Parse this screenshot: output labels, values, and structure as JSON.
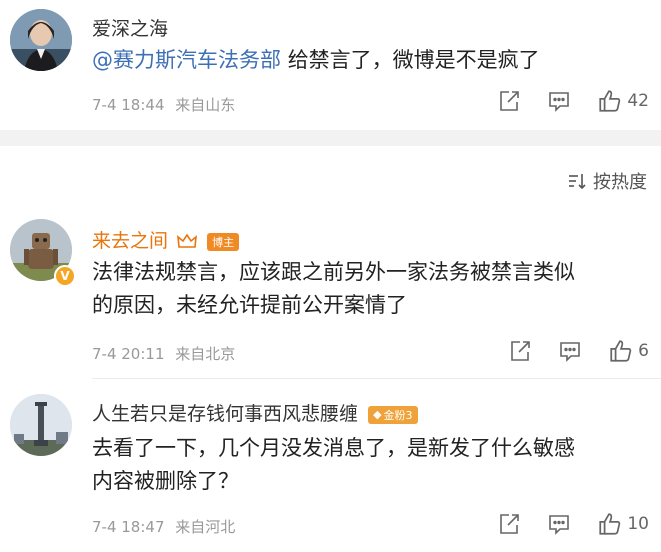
{
  "post": {
    "author": "爱深之海",
    "mention": "@赛力斯汽车法务部",
    "text": "给禁言了，微博是不是疯了",
    "date": "7-4 18:44",
    "location": "来自山东",
    "likes": "42"
  },
  "sort": {
    "label": "按热度"
  },
  "comments": [
    {
      "author": "来去之间",
      "badge": "博主",
      "line1": "法律法规禁言，应该跟之前另外一家法务被禁言类似",
      "line2": "的原因，未经允许提前公开案情了",
      "date": "7-4 20:11",
      "location": "来自北京",
      "likes": "6"
    },
    {
      "author": "人生若只是存钱何事西风悲腰缠",
      "badge": "金粉3",
      "line1": "去看了一下，几个月没发消息了，是新发了什么敏感",
      "line2": "内容被删除了？",
      "date": "7-4 18:47",
      "location": "来自河北",
      "likes": "10"
    }
  ],
  "colors": {
    "accent": "#e8750c",
    "link": "#3c6fb6",
    "muted": "#999999",
    "badge_gold": "#f0a23a"
  }
}
